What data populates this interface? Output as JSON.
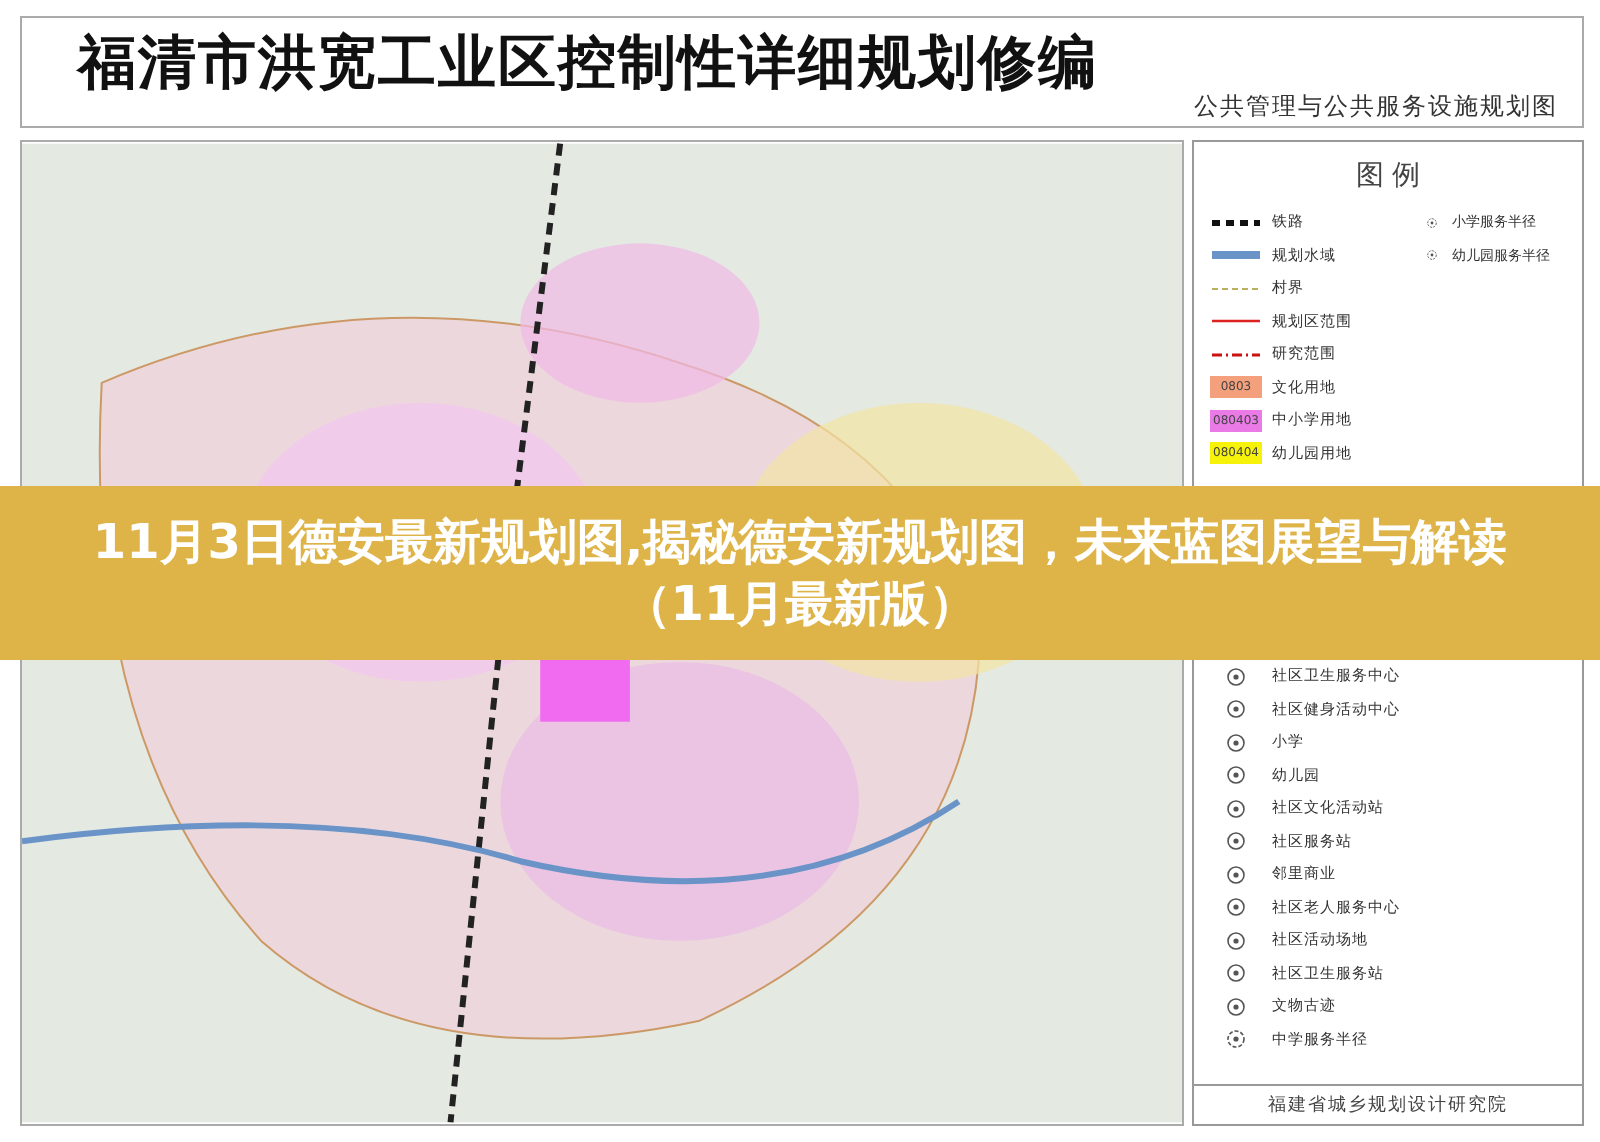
{
  "header": {
    "title": "福清市洪宽工业区控制性详细规划修编",
    "subtitle": "公共管理与公共服务设施规划图"
  },
  "legend": {
    "title": "图 例",
    "items_top": [
      {
        "kind": "line",
        "label": "铁路"
      },
      {
        "kind": "line",
        "label": "规划水域"
      },
      {
        "kind": "line",
        "label": "村界"
      },
      {
        "kind": "line",
        "label": "规划区范围"
      },
      {
        "kind": "line",
        "label": "研究范围"
      },
      {
        "kind": "swatch",
        "color": "#f4a07c",
        "code": "0803",
        "label": "文化用地"
      },
      {
        "kind": "swatch",
        "color": "#e97ae6",
        "code": "080403",
        "label": "中小学用地"
      },
      {
        "kind": "swatch",
        "color": "#f6f20a",
        "code": "080404",
        "label": "幼儿园用地"
      }
    ],
    "items_bottom": [
      {
        "kind": "symbol",
        "label": "社区卫生服务中心"
      },
      {
        "kind": "symbol",
        "label": "社区健身活动中心"
      },
      {
        "kind": "symbol",
        "label": "小学"
      },
      {
        "kind": "symbol",
        "label": "幼儿园"
      },
      {
        "kind": "symbol",
        "label": "社区文化活动站"
      },
      {
        "kind": "symbol",
        "label": "社区服务站"
      },
      {
        "kind": "symbol",
        "label": "邻里商业"
      },
      {
        "kind": "symbol",
        "label": "社区老人服务中心"
      },
      {
        "kind": "symbol",
        "label": "社区活动场地"
      },
      {
        "kind": "symbol",
        "label": "社区卫生服务站"
      },
      {
        "kind": "symbol",
        "label": "文物古迹"
      },
      {
        "kind": "radius",
        "label": "中学服务半径"
      }
    ],
    "side_items": [
      {
        "kind": "radius",
        "label": "小学服务半径"
      },
      {
        "kind": "radius",
        "label": "幼儿园服务半径"
      }
    ],
    "footer": "福建省城乡规划设计研究院"
  },
  "banner": {
    "title": "11月3日德安最新规划图,揭秘德安新规划图，未来蓝图展望与解读（11月最新版）"
  }
}
